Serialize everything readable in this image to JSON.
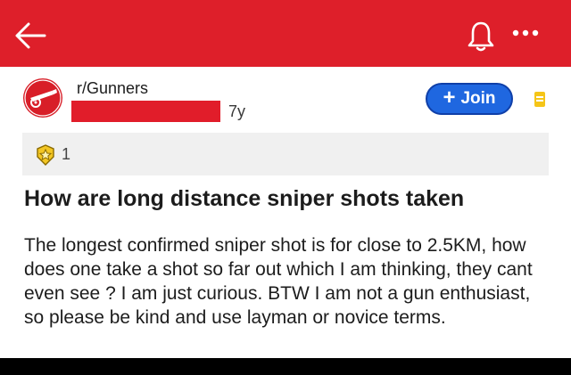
{
  "header": {
    "back_icon": "back-arrow-icon",
    "bell_icon": "bell-icon",
    "more_icon": "more-horizontal-icon",
    "accent_color": "#de1f2a"
  },
  "post": {
    "subreddit": "r/Gunners",
    "age": "7y",
    "join_label": "Join",
    "award_count": "1",
    "title": "How are long distance sniper shots taken",
    "body": "The longest confirmed sniper shot is for close to 2.5KM, how does one take a shot so far out which I am thinking, they cant even see ? I am just curious. BTW I am not a gun enthusiast, so please be kind and use layman or novice terms."
  },
  "colors": {
    "join_button": "#1f67e0",
    "redaction": "#e11d2a"
  }
}
